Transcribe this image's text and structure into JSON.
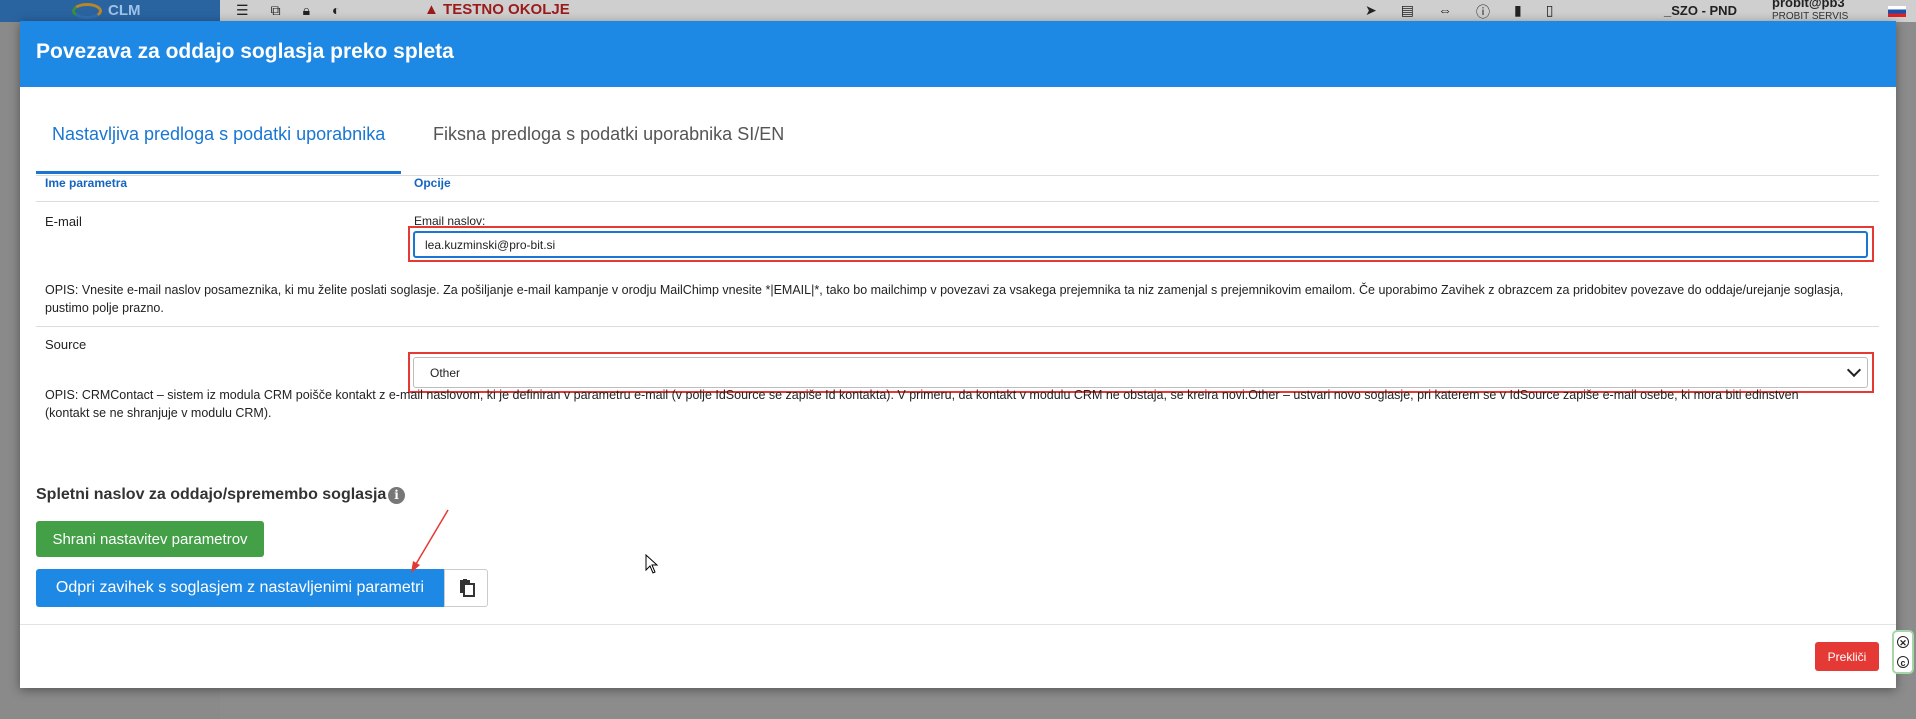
{
  "app": {
    "logo_text": "CLM",
    "test_warning": "TESTNO OKOLJE",
    "user_code": "_SZO - PND",
    "user_name": "probit@pb3",
    "user_company": "PROBIT SERVIS"
  },
  "modal": {
    "title": "Povezava za oddajo soglasja preko spleta",
    "tabs": [
      {
        "label": "Nastavljiva predloga s podatki uporabnika",
        "active": true
      },
      {
        "label": "Fiksna predloga s podatki uporabnika SI/EN",
        "active": false
      }
    ],
    "table": {
      "col_name": "Ime parametra",
      "col_options": "Opcije",
      "email": {
        "name": "E-mail",
        "field_label": "Email naslov:",
        "value": "lea.kuzminski@pro-bit.si",
        "description": "OPIS: Vnesite e-mail naslov posameznika, ki mu želite poslati soglasje. Za pošiljanje e-mail kampanje v orodju MailChimp vnesite *|EMAIL|*, tako bo mailchimp v povezavi za vsakega prejemnika ta niz zamenjal s prejemnikovim emailom. Če uporabimo Zavihek z obrazcem za pridobitev povezave do oddaje/urejanje soglasja, pustimo polje prazno."
      },
      "source": {
        "name": "Source",
        "selected": "Other",
        "description": "OPIS: CRMContact – sistem iz modula CRM poišče kontakt z e-mail naslovom, ki je definiran v parametru e-mail (v polje IdSource se zapiše Id kontakta). V primeru, da kontakt v modulu CRM ne obstaja, se kreira novi.Other – ustvari novo soglasje, pri katerem se v IdSource zapiše e-mail osebe, ki mora biti edinstven (kontakt se ne shranjuje v modulu CRM)."
      }
    },
    "section_title": "Spletni naslov za oddajo/spremembo soglasja",
    "save_button": "Shrani nastavitev parametrov",
    "open_button": "Odpri zavihek s soglasjem z nastavljenimi parametri",
    "cancel_button": "Prekliči"
  },
  "colors": {
    "primary": "#1e88e5",
    "success": "#43a047",
    "danger": "#e53935",
    "highlight": "#e53935"
  }
}
